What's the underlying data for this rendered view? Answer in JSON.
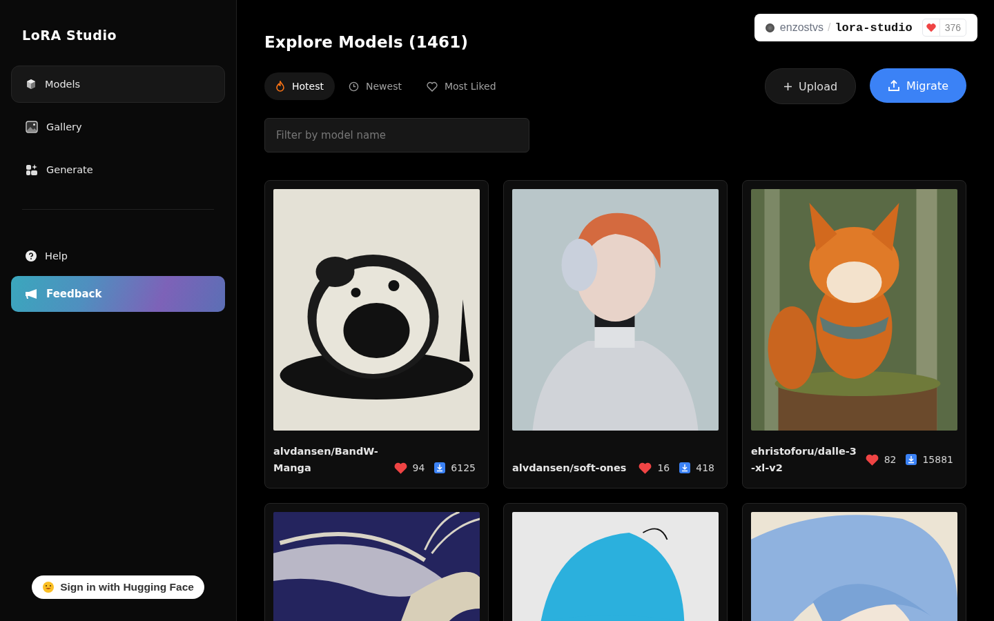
{
  "sidebar": {
    "title": "LoRA Studio",
    "items": [
      {
        "label": "Models",
        "selected": true
      },
      {
        "label": "Gallery",
        "selected": false
      },
      {
        "label": "Generate",
        "selected": false
      }
    ],
    "help": {
      "label": "Help"
    },
    "feedback": {
      "label": "Feedback"
    },
    "sign_in": {
      "label": "Sign in with Hugging Face"
    }
  },
  "repo_badge": {
    "owner": "enzostvs",
    "separator": "/",
    "name": "lora-studio",
    "likes": "376"
  },
  "header": {
    "title": "Explore Models (1461)",
    "tabs": [
      {
        "label": "Hotest",
        "selected": true
      },
      {
        "label": "Newest",
        "selected": false
      },
      {
        "label": "Most Liked",
        "selected": false
      }
    ],
    "buttons": [
      {
        "label": "Upload",
        "kind": "secondary"
      },
      {
        "label": "Migrate",
        "kind": "primary"
      }
    ],
    "filter": {
      "placeholder": "Filter by model name"
    }
  },
  "models": [
    {
      "kind": "model",
      "name": "alvdansen/BandW-Manga",
      "likes": "94",
      "downloads": "6125"
    },
    {
      "kind": "model",
      "name": "alvdansen/soft-ones",
      "likes": "16",
      "downloads": "418"
    },
    {
      "kind": "model",
      "name": "ehristoforu/dalle-3-xl-v2",
      "likes": "82",
      "downloads": "15881"
    },
    {
      "kind": "picture"
    },
    {
      "kind": "picture"
    },
    {
      "kind": "picture"
    }
  ]
}
